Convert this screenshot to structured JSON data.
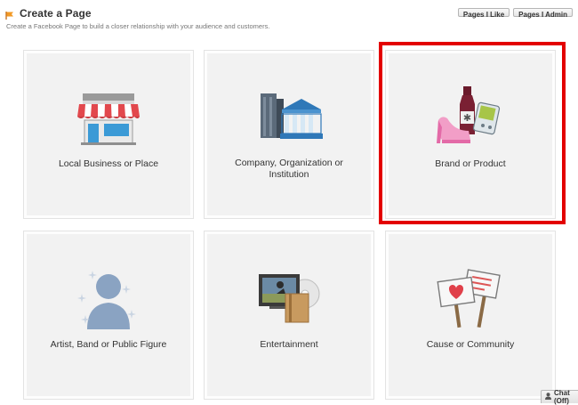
{
  "header": {
    "title": "Create a Page",
    "subtitle": "Create a Facebook Page to build a closer relationship with your audience and customers."
  },
  "top_buttons": {
    "pages_i_like": "Pages I Like",
    "pages_i_admin": "Pages I Admin"
  },
  "categories": [
    {
      "label": "Local Business or Place",
      "icon": "storefront-icon"
    },
    {
      "label": "Company, Organization or Institution",
      "icon": "office-buildings-icon"
    },
    {
      "label": "Brand or Product",
      "icon": "brand-products-icon",
      "highlighted": true
    },
    {
      "label": "Artist, Band or Public Figure",
      "icon": "person-silhouette-icon"
    },
    {
      "label": "Entertainment",
      "icon": "tv-film-icon"
    },
    {
      "label": "Cause or Community",
      "icon": "protest-signs-icon"
    }
  ],
  "highlight_color": "#e30000",
  "chat": {
    "label": "Chat (Off)"
  }
}
